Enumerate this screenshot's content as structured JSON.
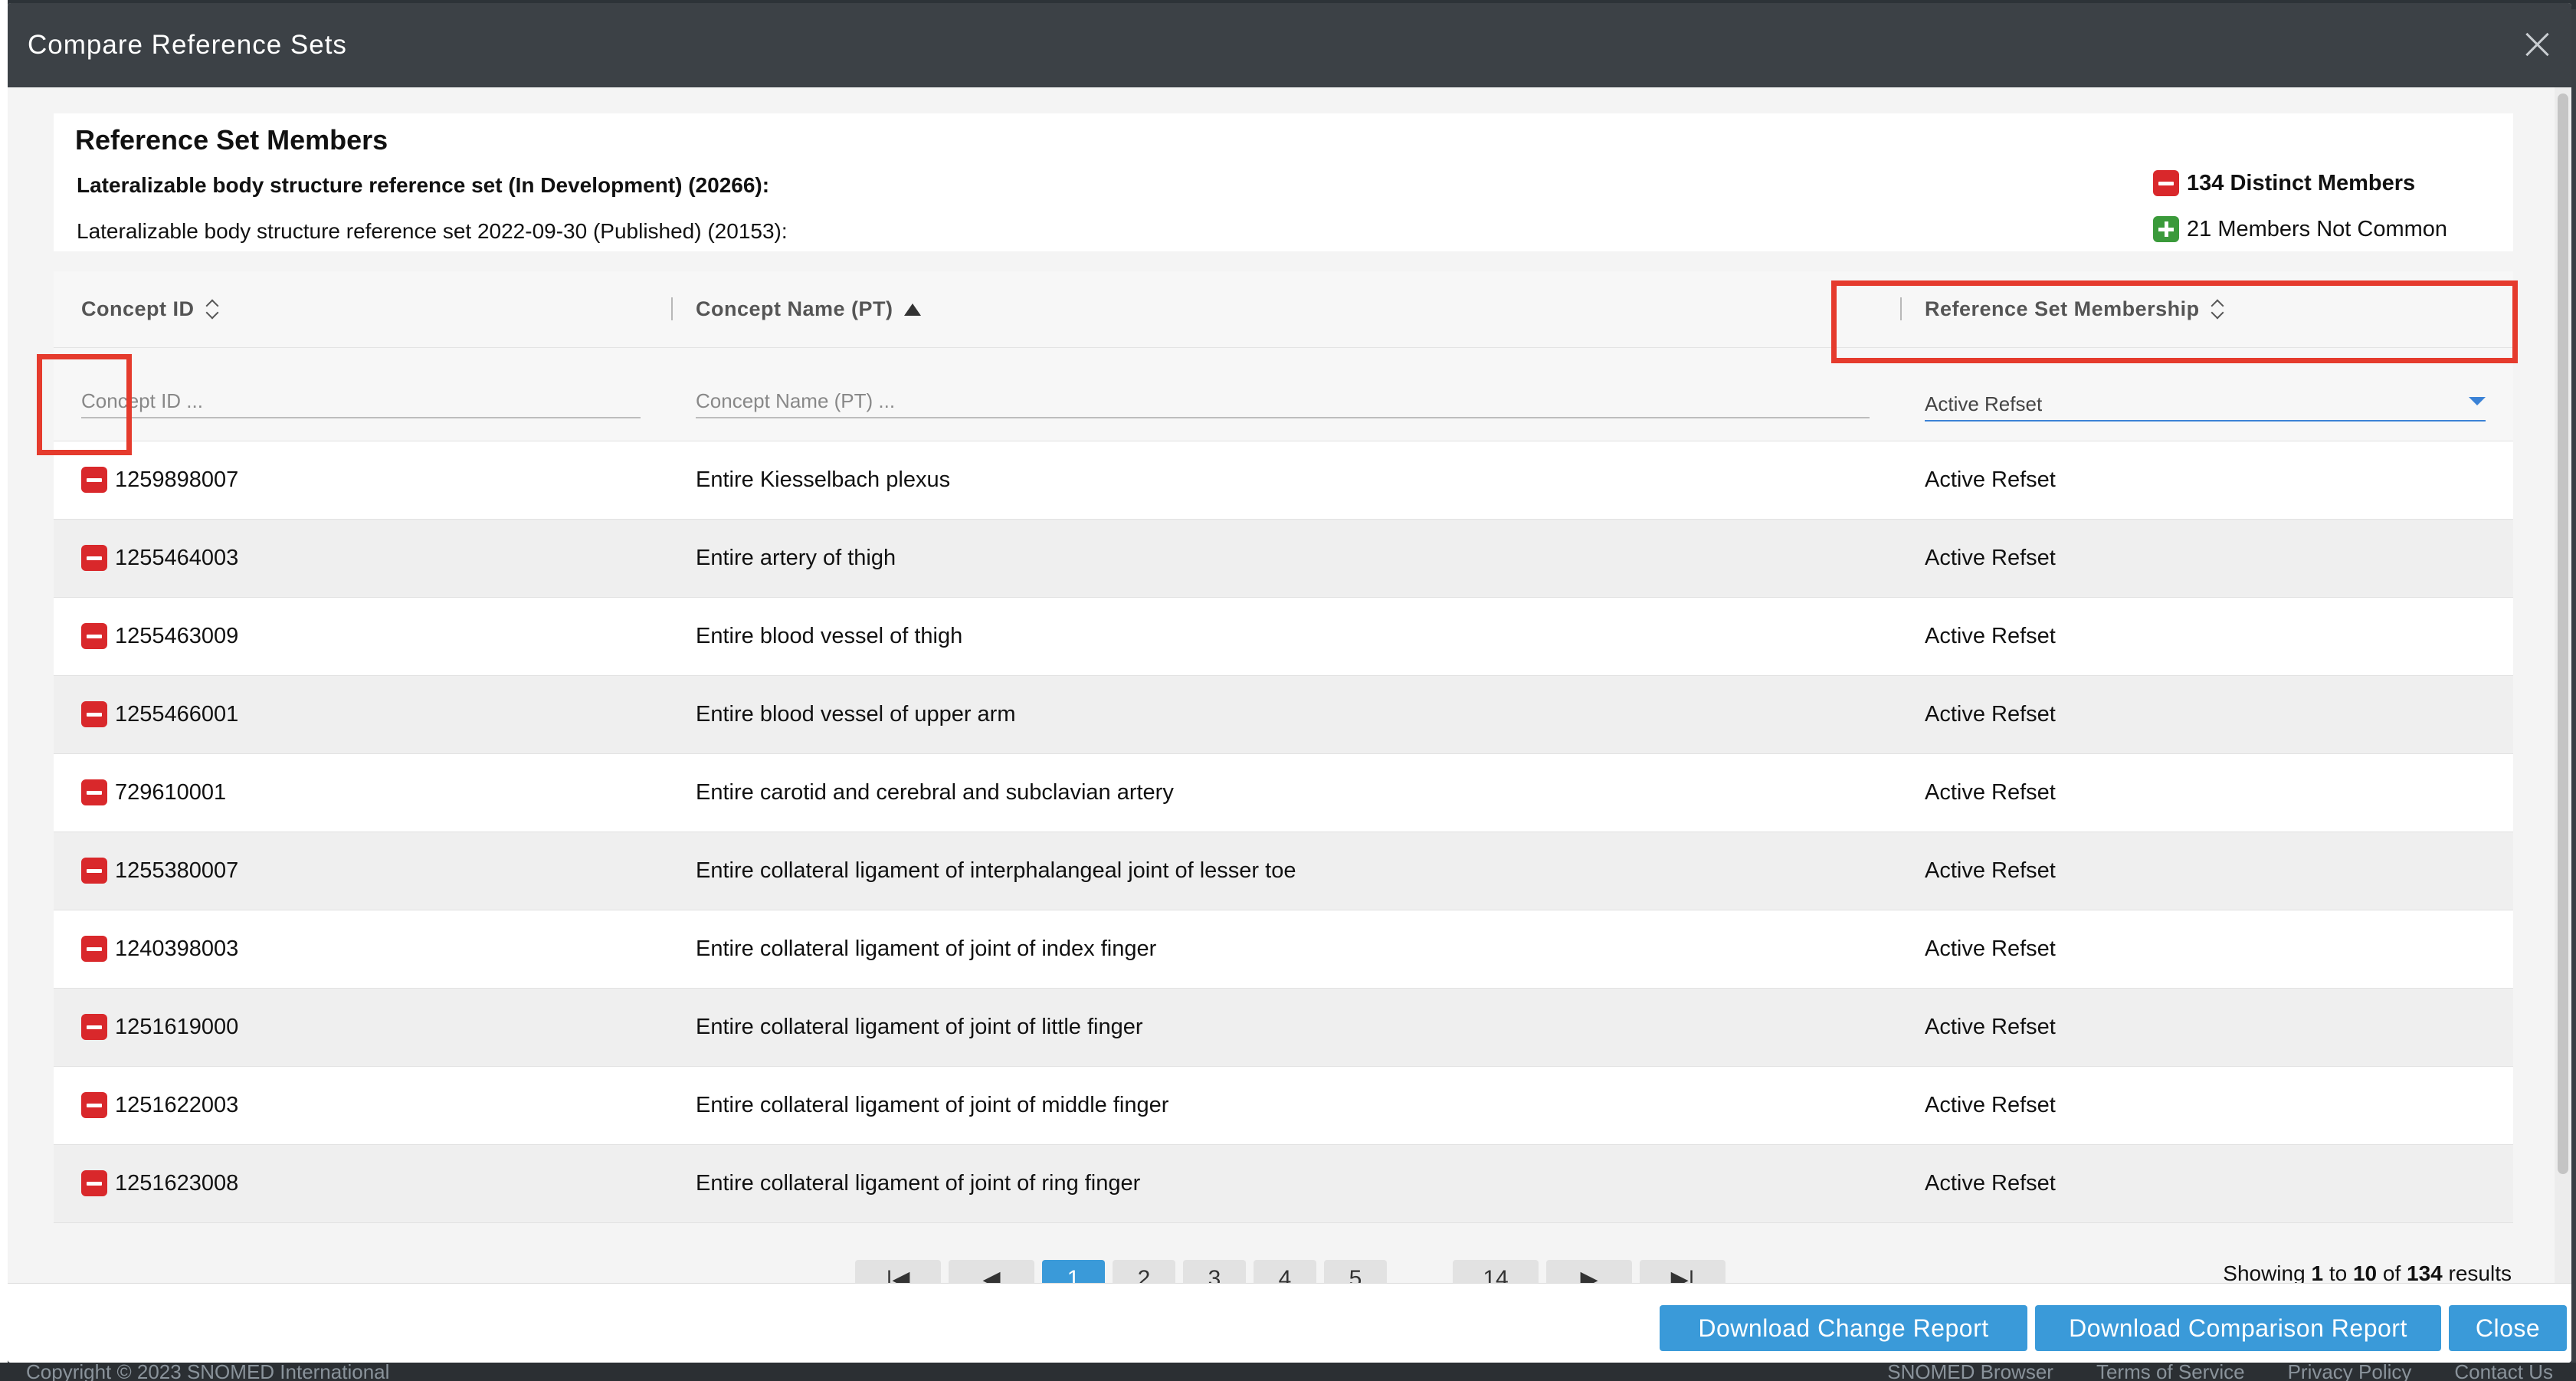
{
  "modal": {
    "title": "Compare Reference Sets"
  },
  "summary": {
    "heading": "Reference Set Members",
    "line1": "Lateralizable body structure reference set (In Development) (20266):",
    "line2": "Lateralizable body structure reference set 2022-09-30 (Published) (20153):",
    "distinct_members": "134 Distinct Members",
    "not_common": "21 Members Not Common"
  },
  "table": {
    "columns": [
      "Concept ID",
      "Concept Name (PT)",
      "Reference Set Membership"
    ],
    "filters": {
      "concept_id_placeholder": "Concept ID ...",
      "concept_name_placeholder": "Concept Name (PT) ...",
      "membership_selected": "Active Refset"
    },
    "rows": [
      {
        "id": "1259898007",
        "name": "Entire Kiesselbach plexus",
        "membership": "Active Refset"
      },
      {
        "id": "1255464003",
        "name": "Entire artery of thigh",
        "membership": "Active Refset"
      },
      {
        "id": "1255463009",
        "name": "Entire blood vessel of thigh",
        "membership": "Active Refset"
      },
      {
        "id": "1255466001",
        "name": "Entire blood vessel of upper arm",
        "membership": "Active Refset"
      },
      {
        "id": "729610001",
        "name": "Entire carotid and cerebral and subclavian artery",
        "membership": "Active Refset"
      },
      {
        "id": "1255380007",
        "name": "Entire collateral ligament of interphalangeal joint of lesser toe",
        "membership": "Active Refset"
      },
      {
        "id": "1240398003",
        "name": "Entire collateral ligament of joint of index finger",
        "membership": "Active Refset"
      },
      {
        "id": "1251619000",
        "name": "Entire collateral ligament of joint of little finger",
        "membership": "Active Refset"
      },
      {
        "id": "1251622003",
        "name": "Entire collateral ligament of joint of middle finger",
        "membership": "Active Refset"
      },
      {
        "id": "1251623008",
        "name": "Entire collateral ligament of joint of ring finger",
        "membership": "Active Refset"
      }
    ]
  },
  "pagination": {
    "pages": [
      "1",
      "2",
      "3",
      "4",
      "5"
    ],
    "last_page": "14",
    "active_page": "1",
    "results": {
      "prefix": "Showing",
      "from": "1",
      "to_word": "to",
      "to": "10",
      "of_word": "of",
      "total": "134",
      "suffix": "results"
    }
  },
  "footer": {
    "download_change": "Download Change Report",
    "download_comparison": "Download Comparison Report",
    "close": "Close"
  },
  "background": {
    "copyright": "Copyright © 2023 SNOMED International",
    "links": [
      "SNOMED Browser",
      "Terms of Service",
      "Privacy Policy",
      "Contact Us"
    ]
  },
  "colors": {
    "accent": "#3a9ad9",
    "removed": "#d9282b",
    "added": "#3a9a3a",
    "highlight": "#e53b2d",
    "header": "#3c4146"
  }
}
